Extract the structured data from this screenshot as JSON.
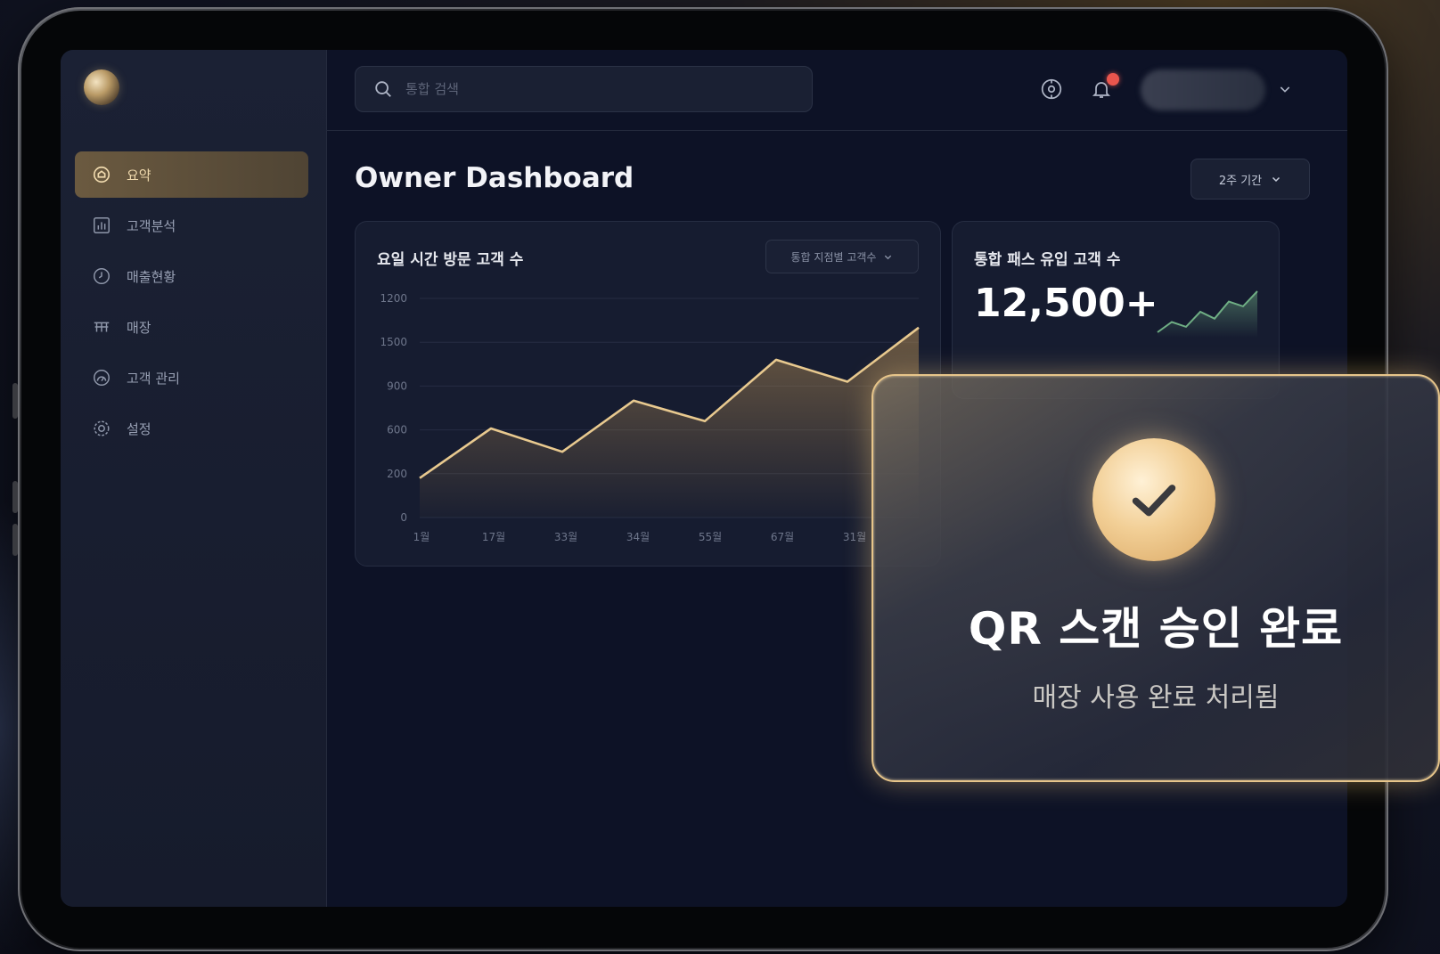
{
  "sidebar": {
    "items": [
      {
        "label": "요약",
        "icon": "home-icon",
        "active": true
      },
      {
        "label": "고객분석",
        "icon": "bar-chart-icon",
        "active": false
      },
      {
        "label": "매출현황",
        "icon": "clock-icon",
        "active": false
      },
      {
        "label": "매장",
        "icon": "store-icon",
        "active": false
      },
      {
        "label": "고객 관리",
        "icon": "gauge-icon",
        "active": false
      },
      {
        "label": "설정",
        "icon": "gear-icon",
        "active": false
      }
    ]
  },
  "header": {
    "search_placeholder": "통합 검색"
  },
  "main": {
    "page_title": "Owner Dashboard",
    "period_select": "2주 기간"
  },
  "chart_card": {
    "title": "요일 시간 방문 고객 수",
    "filter": "통합 지점별 고객수"
  },
  "chart_data": {
    "type": "area",
    "title": "요일 시간 방문 고객 수",
    "y_ticks": [
      "1200",
      "1500",
      "900",
      "600",
      "200",
      "0"
    ],
    "x_ticks": [
      "1월",
      "17월",
      "33월",
      "34월",
      "55월",
      "67월",
      "31월"
    ],
    "values": [
      270,
      610,
      450,
      800,
      660,
      1080,
      930,
      1300
    ],
    "ylim": [
      0,
      1500
    ],
    "grid": true,
    "colors": {
      "line": "#e8c98f",
      "fill": "#b08a52"
    }
  },
  "stat_card": {
    "title": "통합 패스 유입 고객 수",
    "value": "12,500+",
    "sparkline": [
      10,
      25,
      18,
      40,
      30,
      55,
      48,
      70
    ]
  },
  "modal": {
    "title": "QR 스캔 승인 완료",
    "subtitle": "매장 사용 완료 처리됨"
  },
  "colors": {
    "accent": "#e7c58a",
    "background": "#0d1226",
    "notification": "#e9554d",
    "positive": "#6fae84"
  }
}
